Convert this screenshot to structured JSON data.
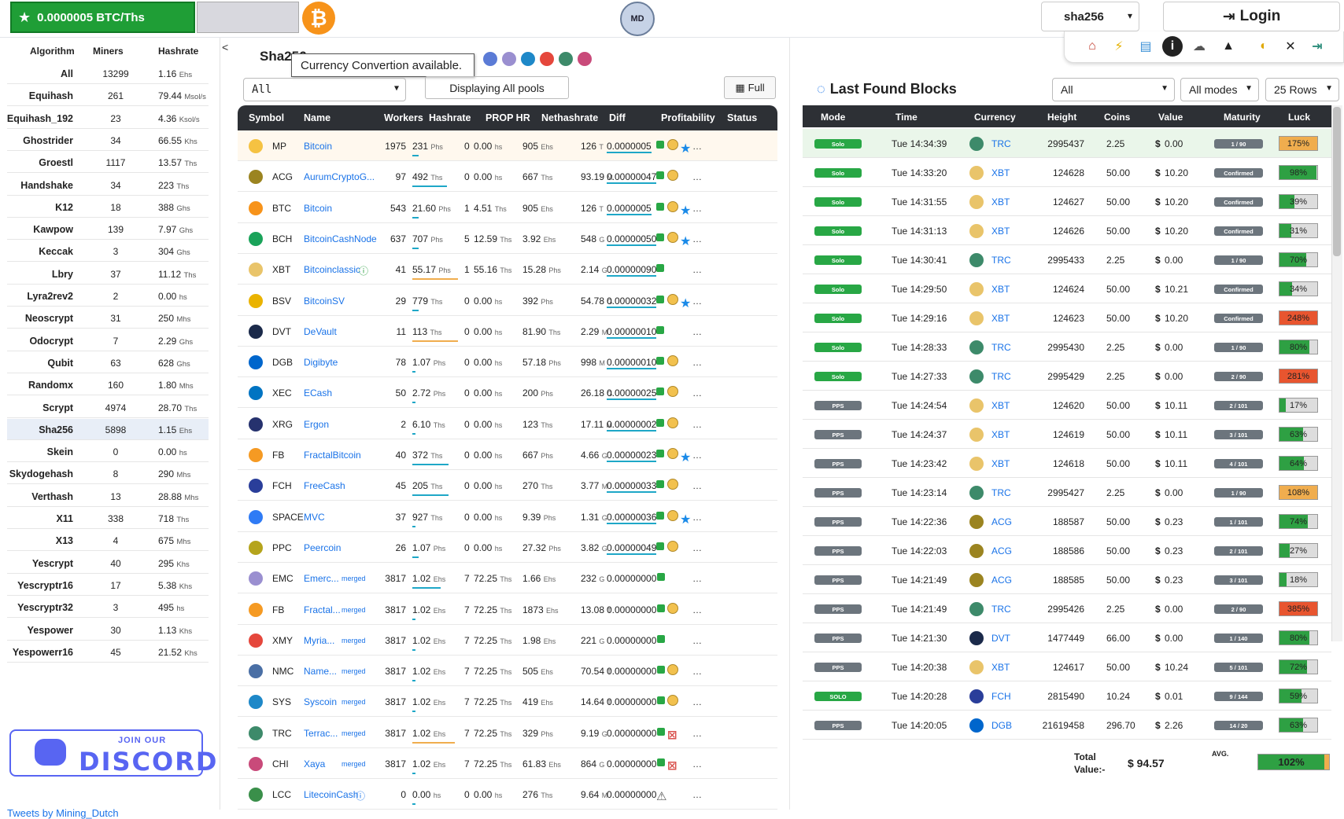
{
  "topbar": {
    "rate": "0.0000005 BTC/Ths",
    "btc_logo": "₿",
    "md_logo": "MD",
    "algo_select": "sha256",
    "login": "Login",
    "icons": [
      "home-icon",
      "lightning-icon",
      "database-icon",
      "info-icon",
      "tutorial-icon",
      "miner-cart-icon",
      "moon-icon",
      "tools-icon",
      "logout-icon"
    ]
  },
  "sidebar": {
    "headers": {
      "algo": "Algorithm",
      "miners": "Miners",
      "hashrate": "Hashrate"
    },
    "collapse": "<",
    "rows": [
      {
        "name": "All",
        "miners": "13299",
        "hr": "1.16",
        "unit": "Ehs"
      },
      {
        "name": "Equihash",
        "miners": "261",
        "hr": "79.44",
        "unit": "Msol/s"
      },
      {
        "name": "Equihash_192",
        "miners": "23",
        "hr": "4.36",
        "unit": "Ksol/s"
      },
      {
        "name": "Ghostrider",
        "miners": "34",
        "hr": "66.55",
        "unit": "Khs"
      },
      {
        "name": "Groestl",
        "miners": "1117",
        "hr": "13.57",
        "unit": "Ths"
      },
      {
        "name": "Handshake",
        "miners": "34",
        "hr": "223",
        "unit": "Ths"
      },
      {
        "name": "K12",
        "miners": "18",
        "hr": "388",
        "unit": "Ghs"
      },
      {
        "name": "Kawpow",
        "miners": "139",
        "hr": "7.97",
        "unit": "Ghs"
      },
      {
        "name": "Keccak",
        "miners": "3",
        "hr": "304",
        "unit": "Ghs"
      },
      {
        "name": "Lbry",
        "miners": "37",
        "hr": "11.12",
        "unit": "Ths"
      },
      {
        "name": "Lyra2rev2",
        "miners": "2",
        "hr": "0.00",
        "unit": "hs"
      },
      {
        "name": "Neoscrypt",
        "miners": "31",
        "hr": "250",
        "unit": "Mhs"
      },
      {
        "name": "Odocrypt",
        "miners": "7",
        "hr": "2.29",
        "unit": "Ghs"
      },
      {
        "name": "Qubit",
        "miners": "63",
        "hr": "628",
        "unit": "Ghs"
      },
      {
        "name": "Randomx",
        "miners": "160",
        "hr": "1.80",
        "unit": "Mhs"
      },
      {
        "name": "Scrypt",
        "miners": "4974",
        "hr": "28.70",
        "unit": "Ths"
      },
      {
        "name": "Sha256",
        "miners": "5898",
        "hr": "1.15",
        "unit": "Ehs"
      },
      {
        "name": "Skein",
        "miners": "0",
        "hr": "0.00",
        "unit": "hs"
      },
      {
        "name": "Skydogehash",
        "miners": "8",
        "hr": "290",
        "unit": "Mhs"
      },
      {
        "name": "Verthash",
        "miners": "13",
        "hr": "28.88",
        "unit": "Mhs"
      },
      {
        "name": "X11",
        "miners": "338",
        "hr": "718",
        "unit": "Ths"
      },
      {
        "name": "X13",
        "miners": "4",
        "hr": "675",
        "unit": "Mhs"
      },
      {
        "name": "Yescrypt",
        "miners": "40",
        "hr": "295",
        "unit": "Khs"
      },
      {
        "name": "Yescryptr16",
        "miners": "17",
        "hr": "5.38",
        "unit": "Khs"
      },
      {
        "name": "Yescryptr32",
        "miners": "3",
        "hr": "495",
        "unit": "hs"
      },
      {
        "name": "Yespower",
        "miners": "30",
        "hr": "1.13",
        "unit": "Khs"
      },
      {
        "name": "Yespowerr16",
        "miners": "45",
        "hr": "21.52",
        "unit": "Khs"
      }
    ],
    "discord_join": "JOIN OUR",
    "discord_name": "DISCORD",
    "tweets": "Tweets by Mining_Dutch"
  },
  "pools": {
    "title": "Sha256",
    "tooltip": "Currency Convertion available.",
    "select": "All",
    "displaying": "Displaying All pools",
    "full": "Full",
    "headers": [
      "Symbol",
      "Name",
      "Workers",
      "Hashrate",
      "PROP HR",
      "Nethashrate",
      "Diff",
      "Profitability",
      "Status"
    ],
    "rows": [
      {
        "sym": "MP",
        "name": "Bitcoin",
        "workers": "1975",
        "hr": "231",
        "hru": "Phs",
        "prop": "0",
        "prophr": "0.00",
        "propu": "hs",
        "net": "905",
        "netu": "Ehs",
        "diff": "126",
        "diffu": "T",
        "prof": "0.0000005",
        "color": "#f5c242",
        "st": "cs"
      },
      {
        "sym": "ACG",
        "name": "AurumCryptoG...",
        "workers": "97",
        "hr": "492",
        "hru": "Ths",
        "prop": "0",
        "prophr": "0.00",
        "propu": "hs",
        "net": "667",
        "netu": "Ths",
        "diff": "93.19",
        "diffu": "M",
        "prof": "0.00000047",
        "color": "#9b8420",
        "st": "c"
      },
      {
        "sym": "BTC",
        "name": "Bitcoin",
        "workers": "543",
        "hr": "21.60",
        "hru": "Phs",
        "prop": "1",
        "prophr": "4.51",
        "propu": "Ths",
        "net": "905",
        "netu": "Ehs",
        "diff": "126",
        "diffu": "T",
        "prof": "0.0000005",
        "color": "#f7931a",
        "st": "cs"
      },
      {
        "sym": "BCH",
        "name": "BitcoinCashNode",
        "workers": "637",
        "hr": "707",
        "hru": "Phs",
        "prop": "5",
        "prophr": "12.59",
        "propu": "Ths",
        "net": "3.92",
        "netu": "Ehs",
        "diff": "548",
        "diffu": "G",
        "prof": "0.00000050",
        "color": "#1aa35a",
        "st": "cs"
      },
      {
        "sym": "XBT",
        "name": "Bitcoinclassic",
        "workers": "41",
        "hr": "55.17",
        "hru": "Phs",
        "prop": "1",
        "prophr": "55.16",
        "propu": "Ths",
        "net": "15.28",
        "netu": "Phs",
        "diff": "2.14",
        "diffu": "G",
        "prof": "0.00000090",
        "color": "#e9c46a",
        "st": "n"
      },
      {
        "sym": "BSV",
        "name": "BitcoinSV",
        "workers": "29",
        "hr": "779",
        "hru": "Ths",
        "prop": "0",
        "prophr": "0.00",
        "propu": "hs",
        "net": "392",
        "netu": "Phs",
        "diff": "54.78",
        "diffu": "G",
        "prof": "0.00000032",
        "color": "#eab300",
        "st": "cs"
      },
      {
        "sym": "DVT",
        "name": "DeVault",
        "workers": "11",
        "hr": "113",
        "hru": "Ths",
        "prop": "0",
        "prophr": "0.00",
        "propu": "hs",
        "net": "81.90",
        "netu": "Ths",
        "diff": "2.29",
        "diffu": "M",
        "prof": "0.00000010",
        "color": "#1b2a4a",
        "st": "n"
      },
      {
        "sym": "DGB",
        "name": "Digibyte",
        "workers": "78",
        "hr": "1.07",
        "hru": "Phs",
        "prop": "0",
        "prophr": "0.00",
        "propu": "hs",
        "net": "57.18",
        "netu": "Phs",
        "diff": "998",
        "diffu": "M",
        "prof": "0.00000010",
        "color": "#0066cc",
        "st": "c"
      },
      {
        "sym": "XEC",
        "name": "ECash",
        "workers": "50",
        "hr": "2.72",
        "hru": "Phs",
        "prop": "0",
        "prophr": "0.00",
        "propu": "hs",
        "net": "200",
        "netu": "Phs",
        "diff": "26.18",
        "diffu": "G",
        "prof": "0.00000025",
        "color": "#0074c2",
        "st": "c"
      },
      {
        "sym": "XRG",
        "name": "Ergon",
        "workers": "2",
        "hr": "6.10",
        "hru": "Ths",
        "prop": "0",
        "prophr": "0.00",
        "propu": "hs",
        "net": "123",
        "netu": "Ths",
        "diff": "17.11",
        "diffu": "M",
        "prof": "0.00000002",
        "color": "#26326e",
        "st": "c"
      },
      {
        "sym": "FB",
        "name": "FractalBitcoin",
        "workers": "40",
        "hr": "372",
        "hru": "Ths",
        "prop": "0",
        "prophr": "0.00",
        "propu": "hs",
        "net": "667",
        "netu": "Phs",
        "diff": "4.66",
        "diffu": "G",
        "prof": "0.00000023",
        "color": "#f59a23",
        "st": "cs"
      },
      {
        "sym": "FCH",
        "name": "FreeCash",
        "workers": "45",
        "hr": "205",
        "hru": "Ths",
        "prop": "0",
        "prophr": "0.00",
        "propu": "hs",
        "net": "270",
        "netu": "Ths",
        "diff": "3.77",
        "diffu": "M",
        "prof": "0.00000033",
        "color": "#2a3e9a",
        "st": "c"
      },
      {
        "sym": "SPACE",
        "name": "MVC",
        "workers": "37",
        "hr": "927",
        "hru": "Ths",
        "prop": "0",
        "prophr": "0.00",
        "propu": "hs",
        "net": "9.39",
        "netu": "Phs",
        "diff": "1.31",
        "diffu": "G",
        "prof": "0.00000036",
        "color": "#2f7bf5",
        "st": "cs"
      },
      {
        "sym": "PPC",
        "name": "Peercoin",
        "workers": "26",
        "hr": "1.07",
        "hru": "Phs",
        "prop": "0",
        "prophr": "0.00",
        "propu": "hs",
        "net": "27.32",
        "netu": "Phs",
        "diff": "3.82",
        "diffu": "G",
        "prof": "0.00000049",
        "color": "#b5a41c",
        "st": "c"
      },
      {
        "sym": "EMC",
        "name": "Emerc...",
        "workers": "3817",
        "hr": "1.02",
        "hru": "Ehs",
        "prop": "7",
        "prophr": "72.25",
        "propu": "Ths",
        "net": "1.66",
        "netu": "Ehs",
        "diff": "232",
        "diffu": "G",
        "prof": "0.00000000",
        "color": "#9a8fd0",
        "st": "n",
        "merged": "merged"
      },
      {
        "sym": "FB",
        "name": "Fractal...",
        "workers": "3817",
        "hr": "1.02",
        "hru": "Ehs",
        "prop": "7",
        "prophr": "72.25",
        "propu": "Ths",
        "net": "1873",
        "netu": "Ehs",
        "diff": "13.08",
        "diffu": "T",
        "prof": "0.00000000",
        "color": "#f59a23",
        "st": "c",
        "merged": "merged"
      },
      {
        "sym": "XMY",
        "name": "Myria...",
        "workers": "3817",
        "hr": "1.02",
        "hru": "Ehs",
        "prop": "7",
        "prophr": "72.25",
        "propu": "Ths",
        "net": "1.98",
        "netu": "Ehs",
        "diff": "221",
        "diffu": "G",
        "prof": "0.00000000",
        "color": "#e5473c",
        "st": "n",
        "merged": "merged"
      },
      {
        "sym": "NMC",
        "name": "Name...",
        "workers": "3817",
        "hr": "1.02",
        "hru": "Ehs",
        "prop": "7",
        "prophr": "72.25",
        "propu": "Ths",
        "net": "505",
        "netu": "Ehs",
        "diff": "70.54",
        "diffu": "T",
        "prof": "0.00000000",
        "color": "#4a6fa5",
        "st": "c",
        "merged": "merged"
      },
      {
        "sym": "SYS",
        "name": "Syscoin",
        "workers": "3817",
        "hr": "1.02",
        "hru": "Ehs",
        "prop": "7",
        "prophr": "72.25",
        "propu": "Ths",
        "net": "419",
        "netu": "Ehs",
        "diff": "14.64",
        "diffu": "T",
        "prof": "0.00000000",
        "color": "#1e88c8",
        "st": "c",
        "merged": "merged"
      },
      {
        "sym": "TRC",
        "name": "Terrac...",
        "workers": "3817",
        "hr": "1.02",
        "hru": "Ehs",
        "prop": "7",
        "prophr": "72.25",
        "propu": "Ths",
        "net": "329",
        "netu": "Phs",
        "diff": "9.19",
        "diffu": "G",
        "prof": "0.00000000",
        "color": "#3d8a6a",
        "st": "x",
        "merged": "merged"
      },
      {
        "sym": "CHI",
        "name": "Xaya",
        "workers": "3817",
        "hr": "1.02",
        "hru": "Ehs",
        "prop": "7",
        "prophr": "72.25",
        "propu": "Ths",
        "net": "61.83",
        "netu": "Ehs",
        "diff": "864",
        "diffu": "G",
        "prof": "0.00000000",
        "color": "#c94a7a",
        "st": "x",
        "merged": "merged"
      },
      {
        "sym": "LCC",
        "name": "LitecoinCash",
        "workers": "0",
        "hr": "0.00",
        "hru": "hs",
        "prop": "0",
        "prophr": "0.00",
        "propu": "hs",
        "net": "276",
        "netu": "Ths",
        "diff": "9.64",
        "diffu": "M",
        "prof": "0.00000000",
        "color": "#3a8f4a",
        "st": "w"
      }
    ]
  },
  "blocks": {
    "title": "Last Found Blocks",
    "sel_all": "All",
    "sel_modes": "All modes",
    "sel_rows": "25 Rows",
    "headers": [
      "Mode",
      "Time",
      "Currency",
      "Height",
      "Coins",
      "Value",
      "Maturity",
      "Luck"
    ],
    "rows": [
      {
        "mode": "Solo",
        "time": "Tue 14:34:39",
        "cur": "TRC",
        "height": "2995437",
        "coins": "2.25",
        "value": "0.00",
        "mat": "1 / 90",
        "luck": "175%",
        "lp": 100,
        "lc": "#f0ad4e",
        "mc": "gray"
      },
      {
        "mode": "Solo",
        "time": "Tue 14:33:20",
        "cur": "XBT",
        "height": "124628",
        "coins": "50.00",
        "value": "10.20",
        "mat": "Confirmed",
        "luck": "98%",
        "lp": 98,
        "lc": "#2ea043",
        "mc": "gray"
      },
      {
        "mode": "Solo",
        "time": "Tue 14:31:55",
        "cur": "XBT",
        "height": "124627",
        "coins": "50.00",
        "value": "10.20",
        "mat": "Confirmed",
        "luck": "39%",
        "lp": 39,
        "lc": "#2ea043",
        "mc": "gray"
      },
      {
        "mode": "Solo",
        "time": "Tue 14:31:13",
        "cur": "XBT",
        "height": "124626",
        "coins": "50.00",
        "value": "10.20",
        "mat": "Confirmed",
        "luck": "31%",
        "lp": 31,
        "lc": "#2ea043",
        "mc": "gray"
      },
      {
        "mode": "Solo",
        "time": "Tue 14:30:41",
        "cur": "TRC",
        "height": "2995433",
        "coins": "2.25",
        "value": "0.00",
        "mat": "1 / 90",
        "luck": "70%",
        "lp": 70,
        "lc": "#2ea043",
        "mc": "gray"
      },
      {
        "mode": "Solo",
        "time": "Tue 14:29:50",
        "cur": "XBT",
        "height": "124624",
        "coins": "50.00",
        "value": "10.21",
        "mat": "Confirmed",
        "luck": "34%",
        "lp": 34,
        "lc": "#2ea043",
        "mc": "gray"
      },
      {
        "mode": "Solo",
        "time": "Tue 14:29:16",
        "cur": "XBT",
        "height": "124623",
        "coins": "50.00",
        "value": "10.20",
        "mat": "Confirmed",
        "luck": "248%",
        "lp": 100,
        "lc": "#e8552f",
        "mc": "gray"
      },
      {
        "mode": "Solo",
        "time": "Tue 14:28:33",
        "cur": "TRC",
        "height": "2995430",
        "coins": "2.25",
        "value": "0.00",
        "mat": "1 / 90",
        "luck": "80%",
        "lp": 80,
        "lc": "#2ea043",
        "mc": "gray"
      },
      {
        "mode": "Solo",
        "time": "Tue 14:27:33",
        "cur": "TRC",
        "height": "2995429",
        "coins": "2.25",
        "value": "0.00",
        "mat": "2 / 90",
        "luck": "281%",
        "lp": 100,
        "lc": "#e8552f",
        "mc": "gray"
      },
      {
        "mode": "PPS",
        "time": "Tue 14:24:54",
        "cur": "XBT",
        "height": "124620",
        "coins": "50.00",
        "value": "10.11",
        "mat": "2 / 101",
        "luck": "17%",
        "lp": 17,
        "lc": "#2ea043",
        "mc": "gray"
      },
      {
        "mode": "PPS",
        "time": "Tue 14:24:37",
        "cur": "XBT",
        "height": "124619",
        "coins": "50.00",
        "value": "10.11",
        "mat": "3 / 101",
        "luck": "63%",
        "lp": 63,
        "lc": "#2ea043",
        "mc": "gray"
      },
      {
        "mode": "PPS",
        "time": "Tue 14:23:42",
        "cur": "XBT",
        "height": "124618",
        "coins": "50.00",
        "value": "10.11",
        "mat": "4 / 101",
        "luck": "64%",
        "lp": 64,
        "lc": "#2ea043",
        "mc": "gray"
      },
      {
        "mode": "PPS",
        "time": "Tue 14:23:14",
        "cur": "TRC",
        "height": "2995427",
        "coins": "2.25",
        "value": "0.00",
        "mat": "1 / 90",
        "luck": "108%",
        "lp": 100,
        "lc": "#f0ad4e",
        "mc": "gray"
      },
      {
        "mode": "PPS",
        "time": "Tue 14:22:36",
        "cur": "ACG",
        "height": "188587",
        "coins": "50.00",
        "value": "0.23",
        "mat": "1 / 101",
        "luck": "74%",
        "lp": 74,
        "lc": "#2ea043",
        "mc": "gray"
      },
      {
        "mode": "PPS",
        "time": "Tue 14:22:03",
        "cur": "ACG",
        "height": "188586",
        "coins": "50.00",
        "value": "0.23",
        "mat": "2 / 101",
        "luck": "27%",
        "lp": 27,
        "lc": "#2ea043",
        "mc": "gray"
      },
      {
        "mode": "PPS",
        "time": "Tue 14:21:49",
        "cur": "ACG",
        "height": "188585",
        "coins": "50.00",
        "value": "0.23",
        "mat": "3 / 101",
        "luck": "18%",
        "lp": 18,
        "lc": "#2ea043",
        "mc": "gray"
      },
      {
        "mode": "PPS",
        "time": "Tue 14:21:49",
        "cur": "TRC",
        "height": "2995426",
        "coins": "2.25",
        "value": "0.00",
        "mat": "2 / 90",
        "luck": "385%",
        "lp": 100,
        "lc": "#e8552f",
        "mc": "gray"
      },
      {
        "mode": "PPS",
        "time": "Tue 14:21:30",
        "cur": "DVT",
        "height": "1477449",
        "coins": "66.00",
        "value": "0.00",
        "mat": "1 / 140",
        "luck": "80%",
        "lp": 80,
        "lc": "#2ea043",
        "mc": "gray"
      },
      {
        "mode": "PPS",
        "time": "Tue 14:20:38",
        "cur": "XBT",
        "height": "124617",
        "coins": "50.00",
        "value": "10.24",
        "mat": "5 / 101",
        "luck": "72%",
        "lp": 72,
        "lc": "#2ea043",
        "mc": "gray"
      },
      {
        "mode": "SOLO",
        "time": "Tue 14:20:28",
        "cur": "FCH",
        "height": "2815490",
        "coins": "10.24",
        "value": "0.01",
        "mat": "9 / 144",
        "luck": "59%",
        "lp": 59,
        "lc": "#2ea043",
        "mc": "gray"
      },
      {
        "mode": "PPS",
        "time": "Tue 14:20:05",
        "cur": "DGB",
        "height": "21619458",
        "coins": "296.70",
        "value": "2.26",
        "mat": "14 / 20",
        "luck": "63%",
        "lp": 63,
        "lc": "#2ea043",
        "mc": "gray"
      }
    ],
    "total_label_1": "Total",
    "total_label_2": "Value:-",
    "total_value": "$ 94.57",
    "avg_label": "AVG.",
    "avg_value": "102%"
  },
  "colors": {
    "green": "#2ea043",
    "dark_header": "#2d3035",
    "link": "#1a73e8",
    "solo_green": "#28a745",
    "pps_gray": "#6c757d"
  }
}
